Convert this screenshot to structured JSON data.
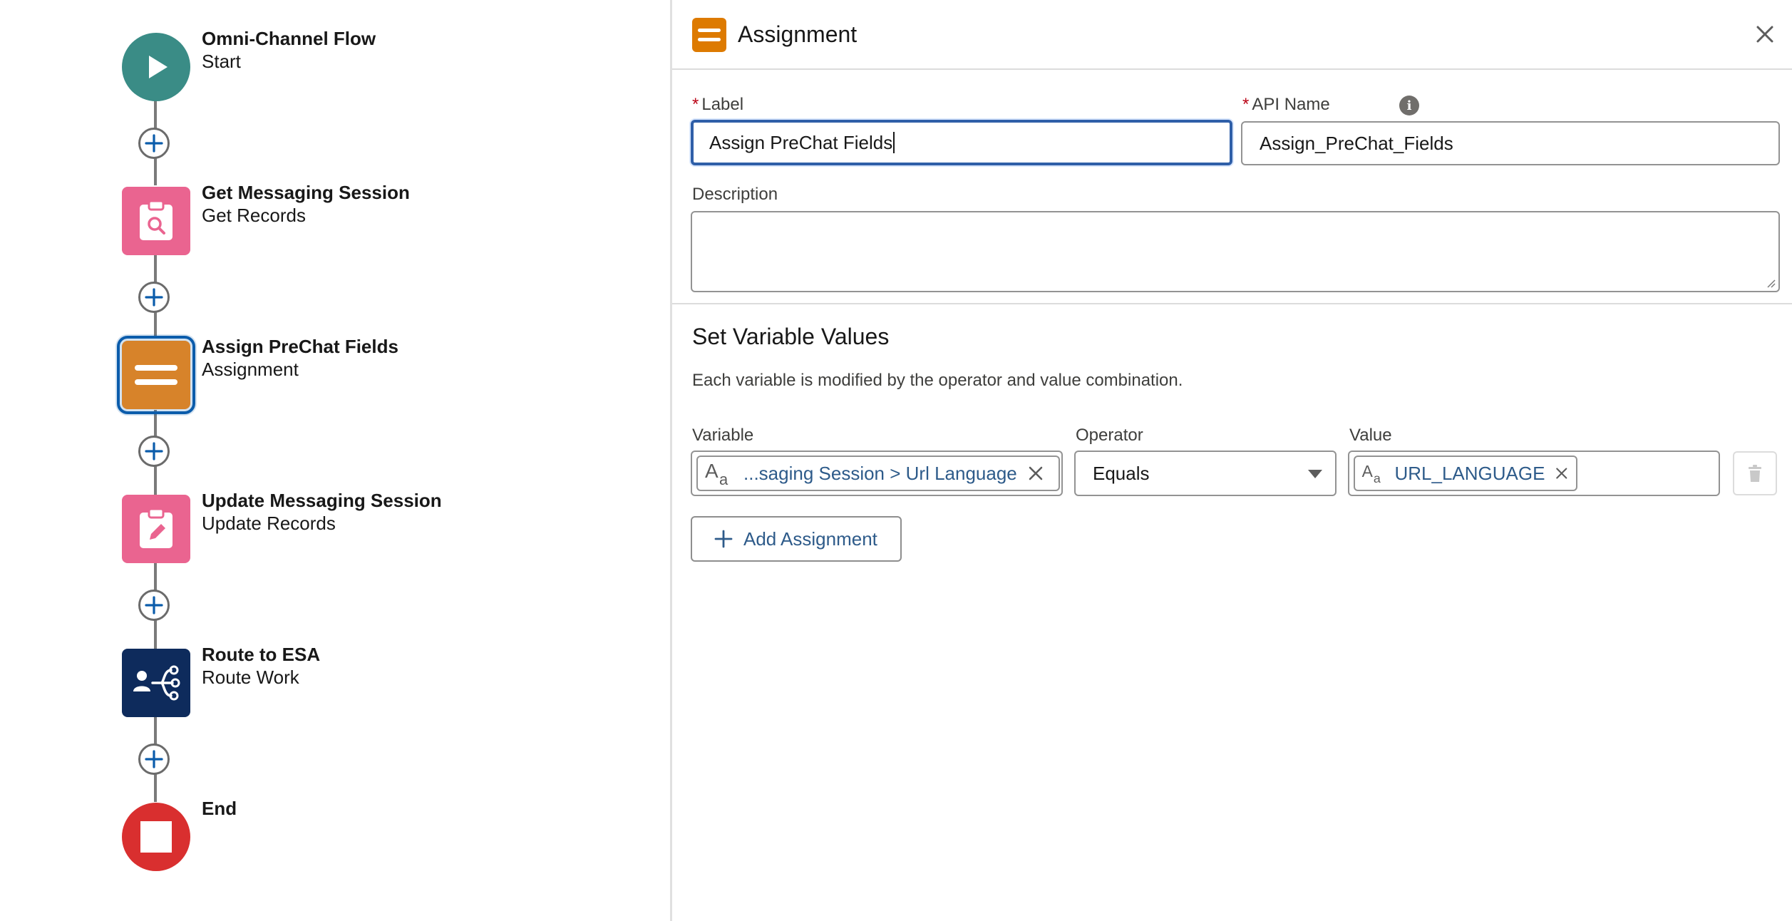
{
  "flow": {
    "nodes": [
      {
        "title": "Omni-Channel Flow",
        "subtitle": "Start",
        "icon": "play-icon",
        "color": "#3a8c86"
      },
      {
        "title": "Get Messaging Session",
        "subtitle": "Get Records",
        "icon": "clipboard-search-icon",
        "color": "#ea6490"
      },
      {
        "title": "Assign PreChat Fields",
        "subtitle": "Assignment",
        "icon": "assignment-equals-icon",
        "color": "#d7832a",
        "selected": true
      },
      {
        "title": "Update Messaging Session",
        "subtitle": "Update Records",
        "icon": "clipboard-edit-icon",
        "color": "#ea6490"
      },
      {
        "title": "Route to ESA",
        "subtitle": "Route Work",
        "icon": "route-work-icon",
        "color": "#0e2b5c"
      },
      {
        "title": "End",
        "subtitle": "",
        "icon": "stop-icon",
        "color": "#d92f2f"
      }
    ]
  },
  "panel": {
    "title": "Assignment",
    "label_field": {
      "label": "Label",
      "value": "Assign PreChat Fields"
    },
    "api_name_field": {
      "label": "API Name",
      "value": "Assign_PreChat_Fields"
    },
    "description_field": {
      "label": "Description",
      "value": ""
    },
    "section": {
      "title": "Set Variable Values",
      "description": "Each variable is modified by the operator and value combination."
    },
    "columns": {
      "variable": "Variable",
      "operator": "Operator",
      "value": "Value"
    },
    "rows": [
      {
        "variable": "...saging Session > Url Language",
        "operator": "Equals",
        "value": "URL_LANGUAGE"
      }
    ],
    "add_assignment_label": "Add Assignment",
    "colors": {
      "accent": "#dd7a01",
      "focus": "#2f5fa8",
      "required": "#ba0517",
      "link": "#2e5b8a"
    }
  }
}
